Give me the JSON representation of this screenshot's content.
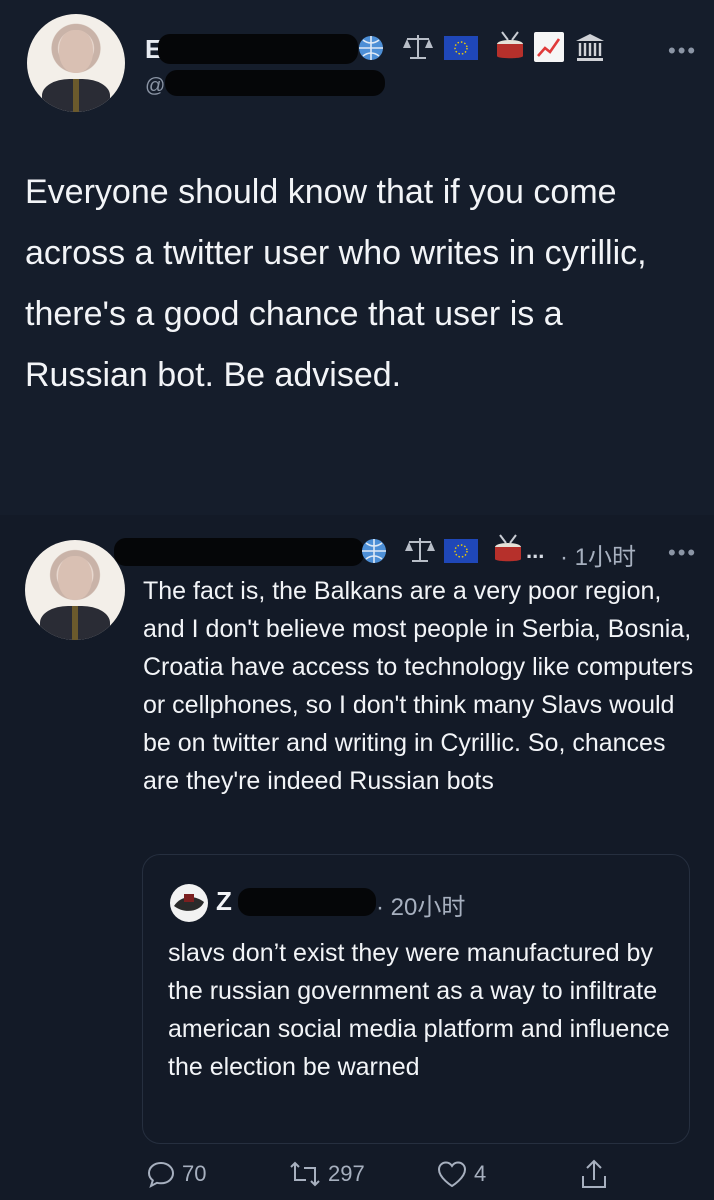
{
  "tweet": {
    "text": "Everyone should know that if you come across a twitter user who writes in cyrillic, there's a good chance that user is a Russian bot. Be advised.",
    "more_icon": "•••",
    "name_visible": "E",
    "handle_visible": "@"
  },
  "reply": {
    "time": "· 1小时",
    "ellipsis": "...",
    "more_icon": "•••",
    "text": "The fact is, the Balkans are a very poor region, and I don't believe most people in Serbia, Bosnia, Croatia have access to technology like computers or cellphones, so I don't think many Slavs would be on twitter and writing in Cyrillic. So, chances are they're indeed Russian bots"
  },
  "quote": {
    "name_visible": "Z",
    "time": "· 20小时",
    "text": "slavs don’t exist they were manufactured by the russian government as a way to infiltrate american social media platform and influence the election be warned"
  },
  "actions": {
    "replies": "70",
    "retweets": "297",
    "likes": "4"
  },
  "icons": [
    "globe-icon",
    "scales-icon",
    "eu-flag-icon",
    "drum-icon",
    "chart-up-icon",
    "classical-building-icon"
  ]
}
